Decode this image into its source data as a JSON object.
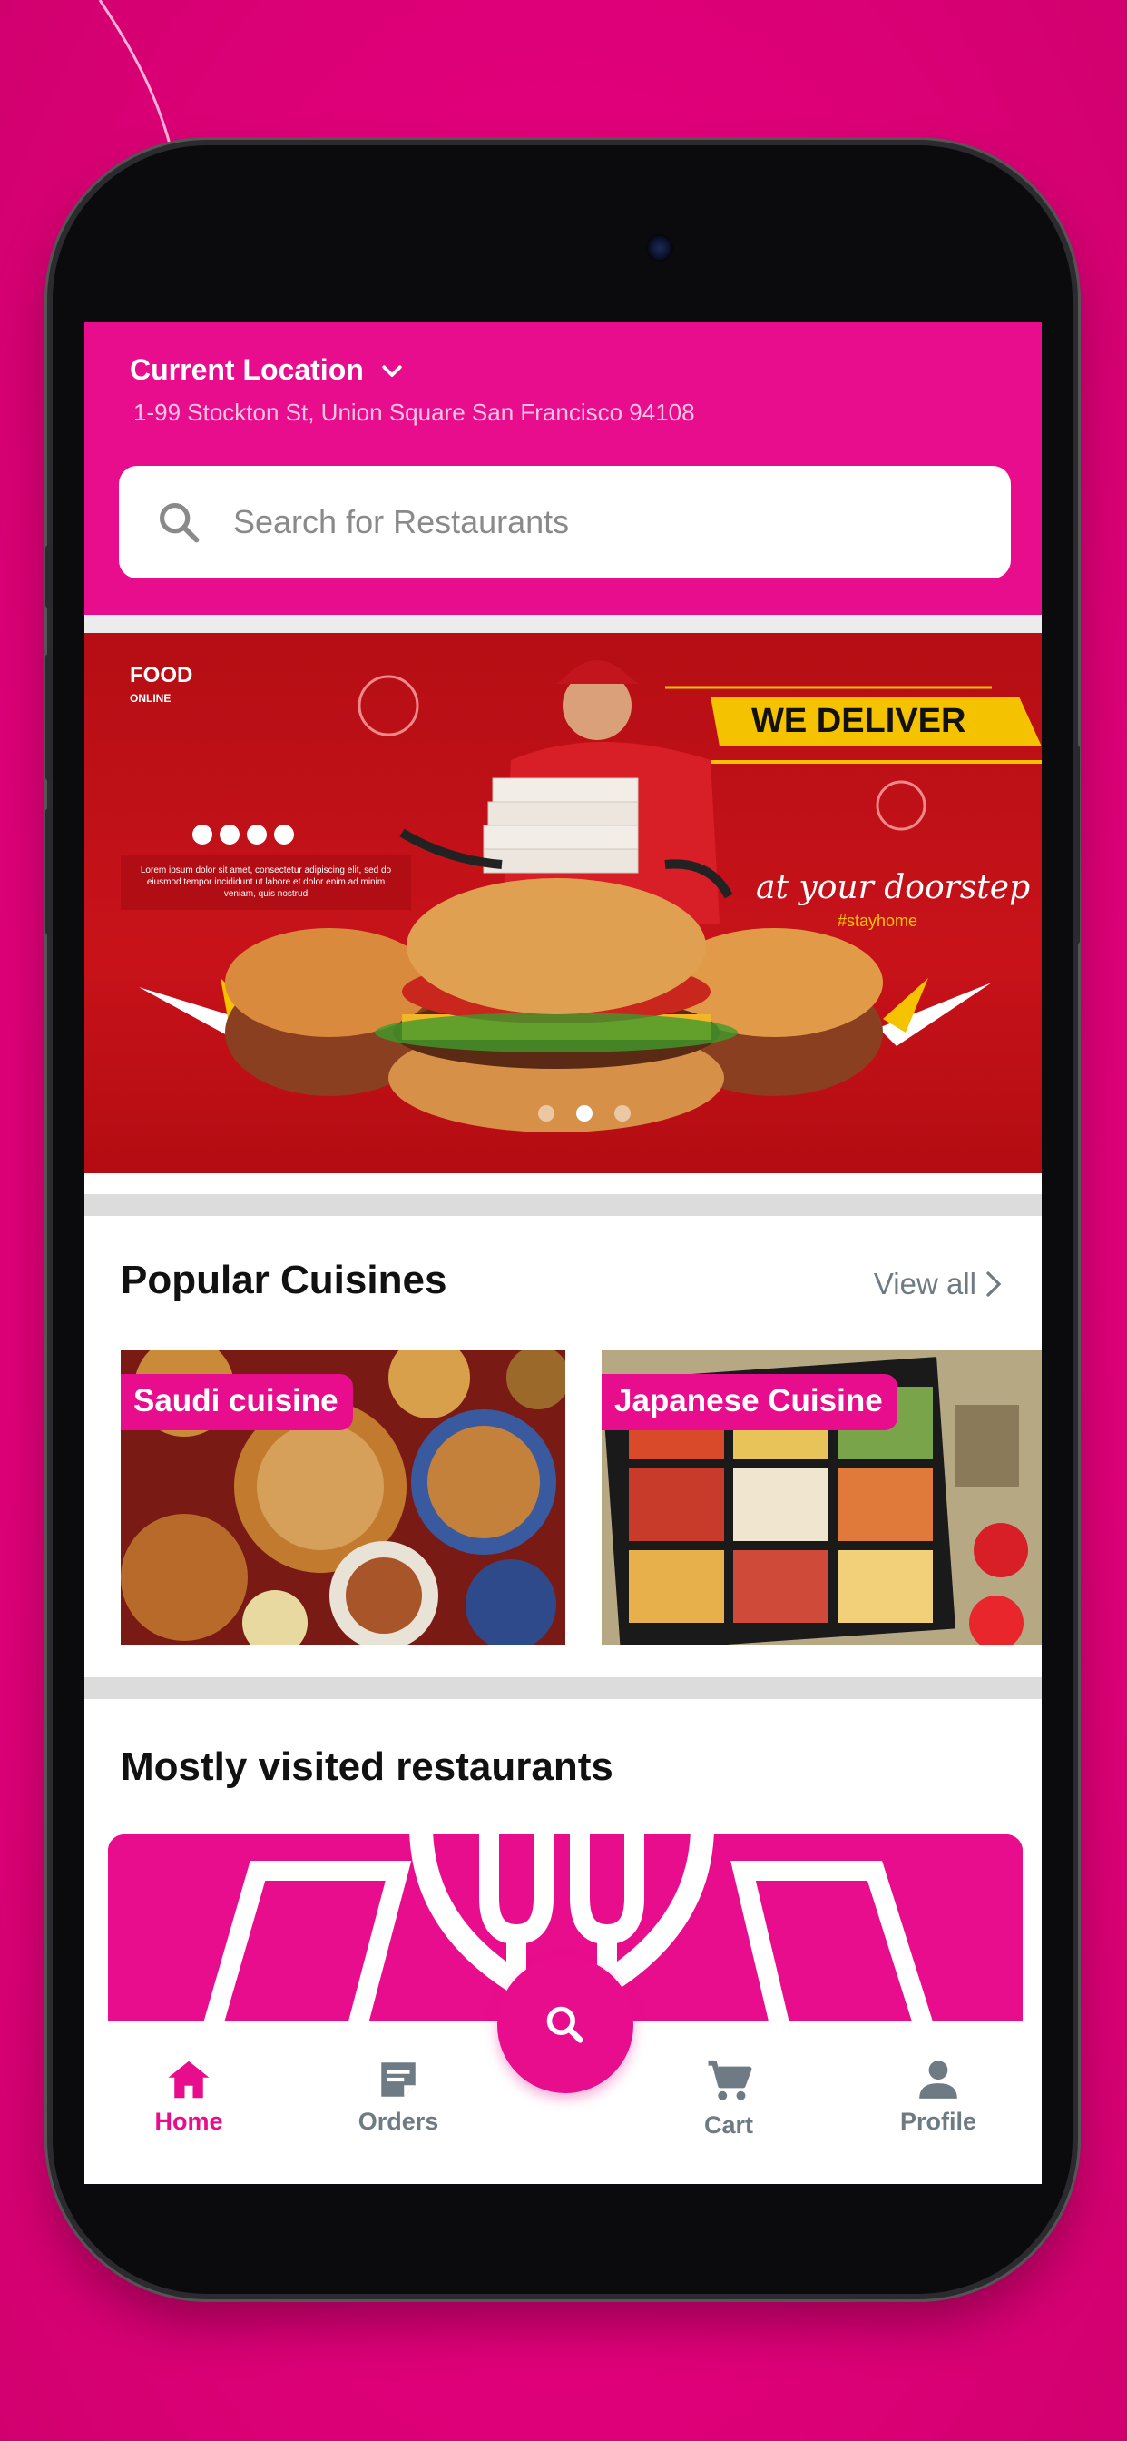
{
  "app": {
    "colors": {
      "brand": "#e80d8c",
      "muted": "#6f7b84",
      "background": "#e4007c"
    }
  },
  "header": {
    "location_title": "Current Location",
    "location_address": "1-99 Stockton St, Union Square  San Francisco  94108",
    "location_icon": "chevron-down-icon"
  },
  "search": {
    "placeholder": "Search for Restaurants",
    "icon": "search-icon"
  },
  "banner": {
    "brand_top": "FOOD",
    "brand_sub": "ONLINE",
    "headline": "WE DELIVER",
    "tagline": "at your doorstep",
    "hashtag": "#stayhome",
    "body_text": "Lorem ipsum dolor sit amet, consectetur adipiscing elit, sed do eiusmod tempor incididunt ut labore et dolor enim ad minim veniam, quis nostrud",
    "carousel_total": 3,
    "carousel_active": 2
  },
  "popular_cuisines": {
    "title": "Popular Cuisines",
    "view_all": "View all",
    "items": [
      {
        "label": "Saudi cuisine"
      },
      {
        "label": "Japanese Cuisine"
      }
    ]
  },
  "mostly_visited": {
    "title": "Mostly visited restaurants"
  },
  "bottom_nav": {
    "items": [
      {
        "label": "Home",
        "icon": "home-icon",
        "active": true
      },
      {
        "label": "Orders",
        "icon": "orders-icon",
        "active": false
      },
      {
        "label": "Cart",
        "icon": "cart-icon",
        "active": false
      },
      {
        "label": "Profile",
        "icon": "profile-icon",
        "active": false
      }
    ],
    "fab_icon": "search-icon"
  }
}
